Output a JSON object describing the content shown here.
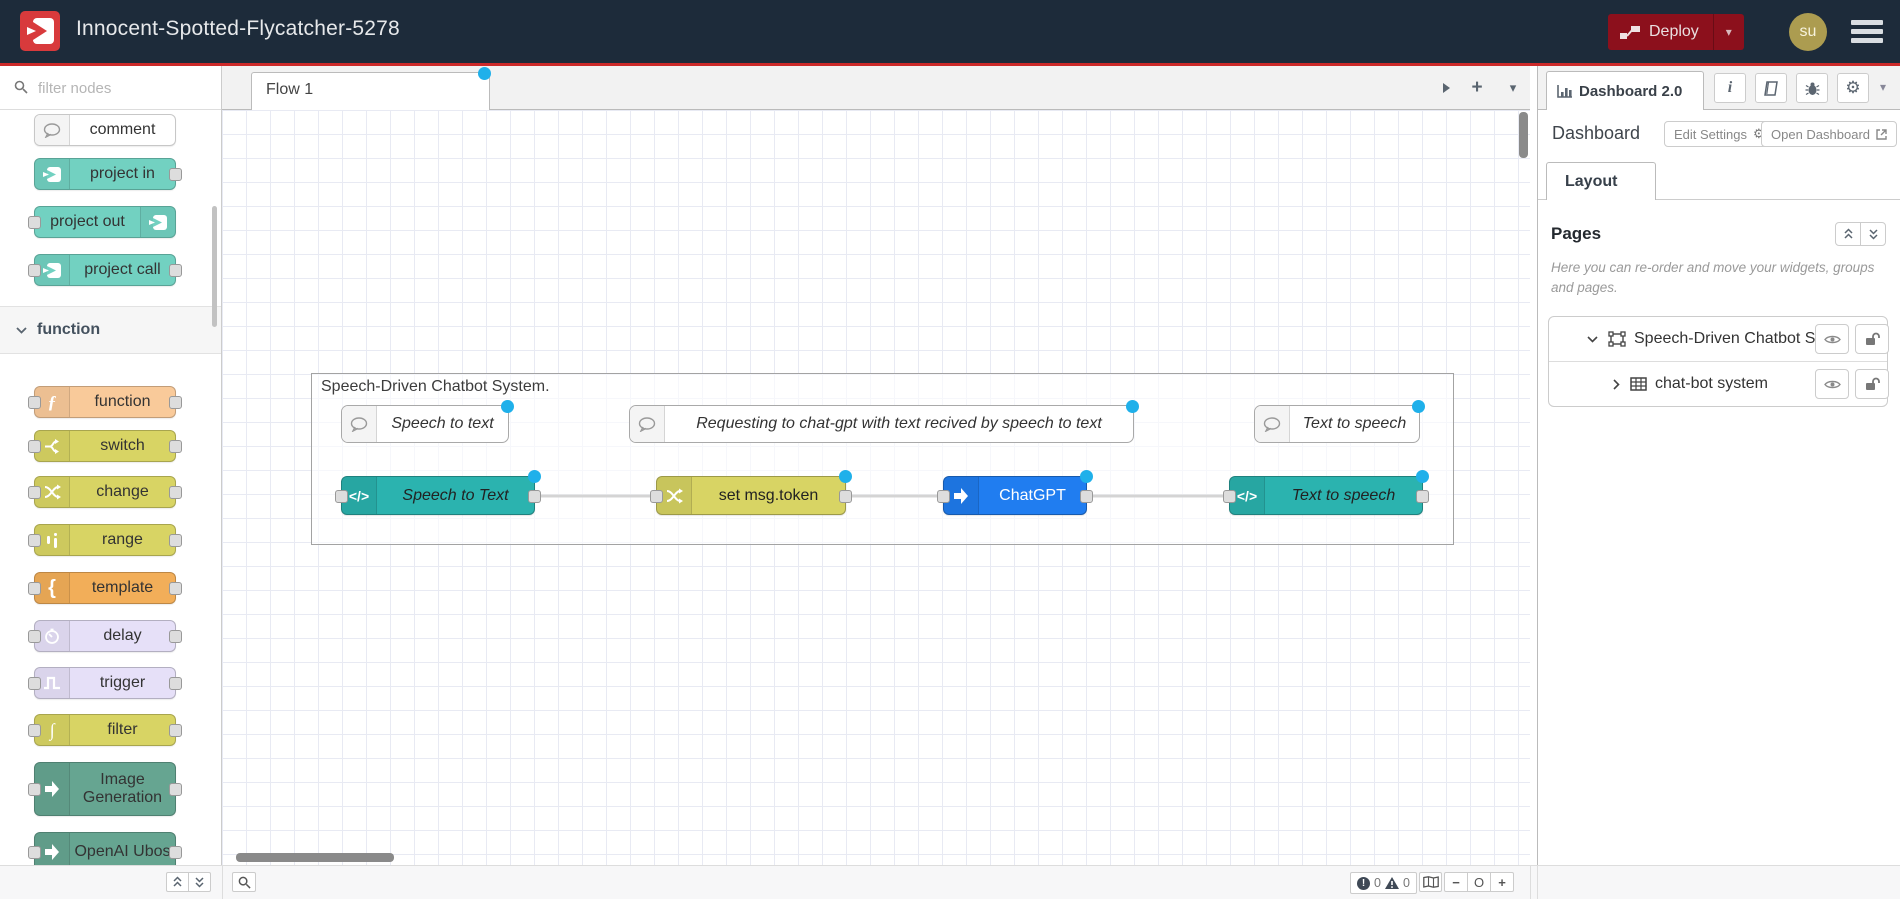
{
  "colors": {
    "header_bg": "#1d2b3a",
    "accent_red": "#cc2929",
    "deploy_bg": "#8c101c",
    "logo_red": "#d83a3c",
    "avatar_bg": "#ac9c50",
    "changed_dot": "#1fb0ea",
    "node_teal": "#2bb3af",
    "node_blue": "#207df0",
    "node_yellow": "#d8d464",
    "node_peach": "#f9ca9a",
    "node_orange": "#f2ae59",
    "node_lavender": "#e6e0f8",
    "node_green": "#66a591",
    "palette_teal": "#72d1c1"
  },
  "header": {
    "title": "Innocent-Spotted-Flycatcher-5278",
    "deploy_label": "Deploy",
    "avatar_text": "su"
  },
  "palette": {
    "search_placeholder": "filter nodes",
    "nodes": [
      {
        "label": "comment"
      },
      {
        "label": "project in"
      },
      {
        "label": "project out"
      },
      {
        "label": "project call"
      }
    ],
    "section_label": "function",
    "function_nodes": [
      {
        "label": "function"
      },
      {
        "label": "switch"
      },
      {
        "label": "change"
      },
      {
        "label": "range"
      },
      {
        "label": "template"
      },
      {
        "label": "delay"
      },
      {
        "label": "trigger"
      },
      {
        "label": "filter"
      },
      {
        "label": "Image Generation"
      },
      {
        "label": "OpenAI Ubos"
      }
    ]
  },
  "workspace": {
    "tab_label": "Flow 1",
    "group_label": "Speech-Driven Chatbot System.",
    "comments": [
      {
        "label": "Speech to text"
      },
      {
        "label": "Requesting to chat-gpt with text recived by speech to text"
      },
      {
        "label": "Text to speech"
      }
    ],
    "nodes": [
      {
        "label": "Speech to Text"
      },
      {
        "label": "set msg.token"
      },
      {
        "label": "ChatGPT"
      },
      {
        "label": "Text to speech"
      }
    ]
  },
  "sidebar": {
    "tab_label": "Dashboard 2.0",
    "section_title": "Dashboard",
    "edit_settings_label": "Edit Settings",
    "open_dashboard_label": "Open Dashboard",
    "layout_tab_label": "Layout",
    "pages_title": "Pages",
    "pages_help": "Here you can re-order and move your widgets, groups and pages.",
    "pages": [
      {
        "label": "Speech-Driven Chatbot S"
      },
      {
        "label": "chat-bot system"
      }
    ]
  },
  "footer": {
    "error_count": "0",
    "warning_count": "0",
    "zoom_out_glyph": "−",
    "zoom_reset_glyph": "O",
    "zoom_in_glyph": "+"
  },
  "icons": {
    "function_glyph": "ƒ",
    "template_glyph": "{",
    "filter_glyph": "∫",
    "code_glyph": "</>",
    "info_glyph": "i",
    "gear_glyph": "⚙"
  }
}
